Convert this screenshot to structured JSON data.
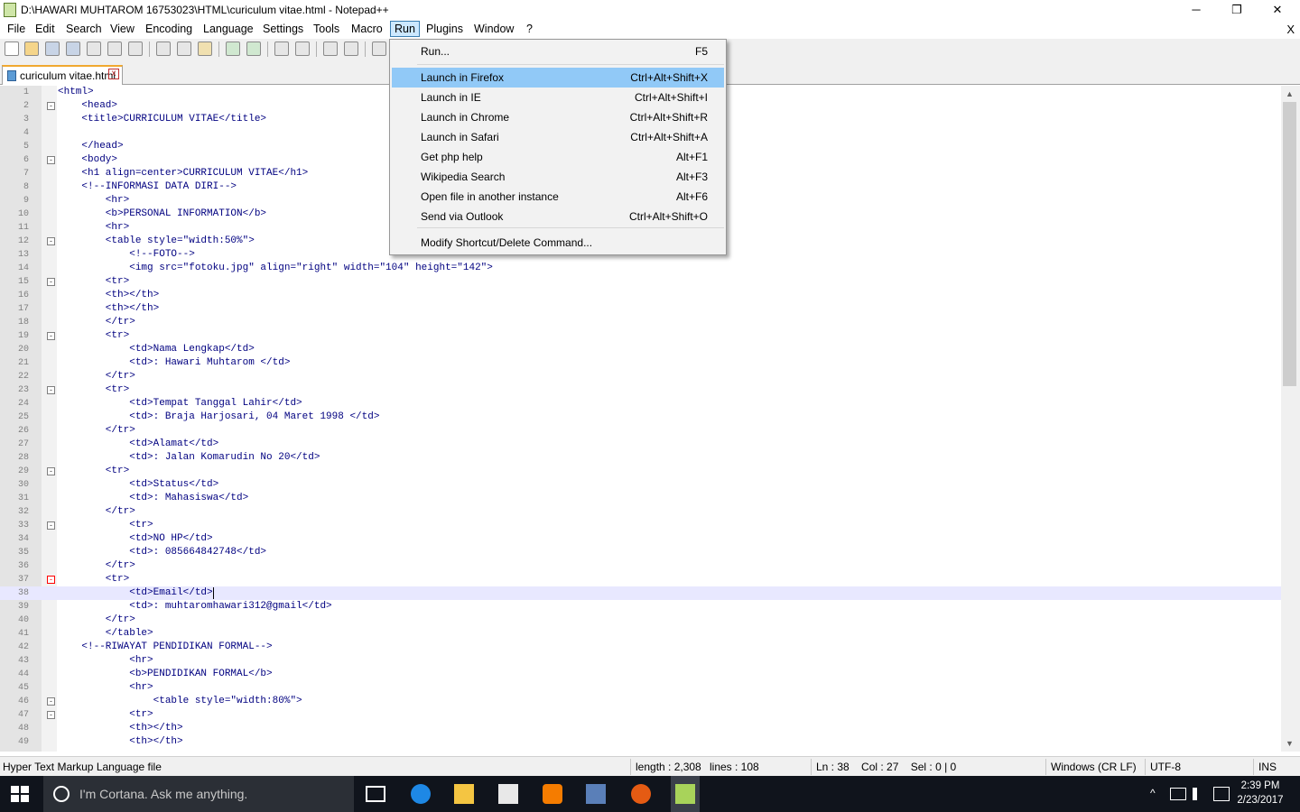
{
  "window": {
    "title": "D:\\HAWARI MUHTAROM 16753023\\HTML\\curiculum vitae.html - Notepad++",
    "minimize": "─",
    "restore": "❐",
    "close": "✕"
  },
  "menubar": {
    "items": [
      "File",
      "Edit",
      "Search",
      "View",
      "Encoding",
      "Language",
      "Settings",
      "Tools",
      "Macro",
      "Run",
      "Plugins",
      "Window",
      "?"
    ],
    "active": "Run",
    "close_doc": "X"
  },
  "tab": {
    "name": "curiculum vitae.html",
    "close": "x"
  },
  "editor": {
    "current_line": 38,
    "folds": {
      "2": "-",
      "6": "-",
      "12": "-",
      "15": "-",
      "19": "-",
      "23": "-",
      "29": "-",
      "33": "-",
      "37": "-",
      "46": "-",
      "47": "-"
    },
    "lines": [
      "<html>",
      "    <head>",
      "    <title>CURRICULUM VITAE</title>",
      "",
      "    </head>",
      "    <body>",
      "    <h1 align=center>CURRICULUM VITAE</h1>",
      "    <!--INFORMASI DATA DIRI-->",
      "        <hr>",
      "        <b>PERSONAL INFORMATION</b>",
      "        <hr>",
      "        <table style=\"width:50%\">",
      "            <!--FOTO-->",
      "            <img src=\"fotoku.jpg\" align=\"right\" width=\"104\" height=\"142\">",
      "        <tr>",
      "        <th></th>",
      "        <th></th>",
      "        </tr>",
      "        <tr>",
      "            <td>Nama Lengkap</td>",
      "            <td>: Hawari Muhtarom </td>",
      "        </tr>",
      "        <tr>",
      "            <td>Tempat Tanggal Lahir</td>",
      "            <td>: Braja Harjosari, 04 Maret 1998 </td>",
      "        </tr>",
      "            <td>Alamat</td>",
      "            <td>: Jalan Komarudin No 20</td>",
      "        <tr>",
      "            <td>Status</td>",
      "            <td>: Mahasiswa</td>",
      "        </tr>",
      "            <tr>",
      "            <td>NO HP</td>",
      "            <td>: 085664842748</td>",
      "        </tr>",
      "        <tr>",
      "            <td>Email</td>",
      "            <td>: muhtaromhawari312@gmail</td>",
      "        </tr>",
      "        </table>",
      "    <!--RIWAYAT PENDIDIKAN FORMAL-->",
      "            <hr>",
      "            <b>PENDIDIKAN FORMAL</b>",
      "            <hr>",
      "                <table style=\"width:80%\">",
      "            <tr>",
      "            <th></th>",
      "            <th></th>"
    ]
  },
  "run_menu": {
    "items": [
      {
        "label": "Run...",
        "shortcut": "F5"
      },
      {
        "label": "Launch in Firefox",
        "shortcut": "Ctrl+Alt+Shift+X",
        "highlighted": true
      },
      {
        "label": "Launch in IE",
        "shortcut": "Ctrl+Alt+Shift+I"
      },
      {
        "label": "Launch in Chrome",
        "shortcut": "Ctrl+Alt+Shift+R"
      },
      {
        "label": "Launch in Safari",
        "shortcut": "Ctrl+Alt+Shift+A"
      },
      {
        "label": "Get php help",
        "shortcut": "Alt+F1"
      },
      {
        "label": "Wikipedia Search",
        "shortcut": "Alt+F3"
      },
      {
        "label": "Open file in another instance",
        "shortcut": "Alt+F6"
      },
      {
        "label": "Send via Outlook",
        "shortcut": "Ctrl+Alt+Shift+O"
      },
      {
        "label": "Modify Shortcut/Delete Command...",
        "shortcut": ""
      }
    ]
  },
  "statusbar": {
    "filetype": "Hyper Text Markup Language file",
    "length": "length : 2,308",
    "lines": "lines : 108",
    "pos": "Ln : 38    Col : 27    Sel : 0 | 0",
    "eol": "Windows (CR LF)",
    "encoding": "UTF-8",
    "mode": "INS"
  },
  "taskbar": {
    "search_placeholder": "I'm Cortana. Ask me anything.",
    "time": "2:39 PM",
    "date": "2/23/2017",
    "tray_chevron": "^"
  }
}
